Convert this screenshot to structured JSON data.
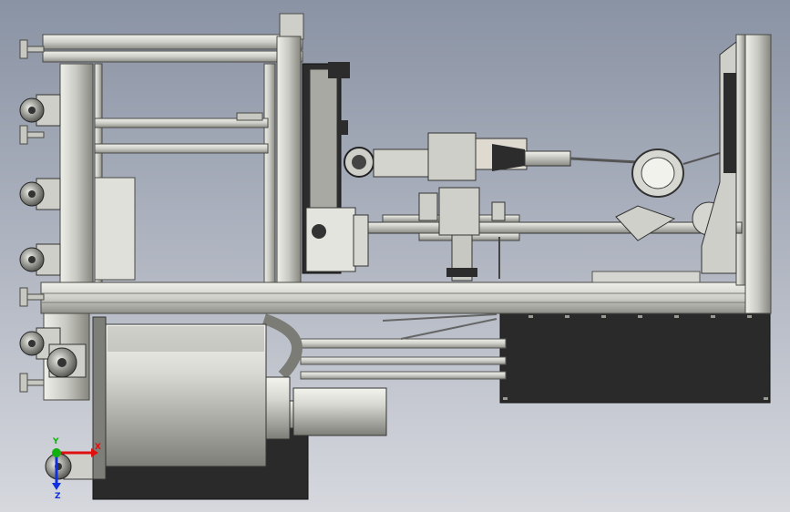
{
  "viewport": {
    "background_top": "#8a93a4",
    "background_bottom": "#d6d8de"
  },
  "colors": {
    "frame_light": "#e2e2dc",
    "frame_mid": "#b9b9b3",
    "frame_dark": "#5a5a56",
    "panel_dark": "#2a2a2a",
    "motor_light": "#e6e6e0",
    "motor_dark": "#8c8c86"
  },
  "triad": {
    "x_label": "X",
    "y_label": "Y",
    "z_label": "Z",
    "x_color": "#e01010",
    "y_color": "#10b010",
    "z_color": "#1030e0"
  }
}
